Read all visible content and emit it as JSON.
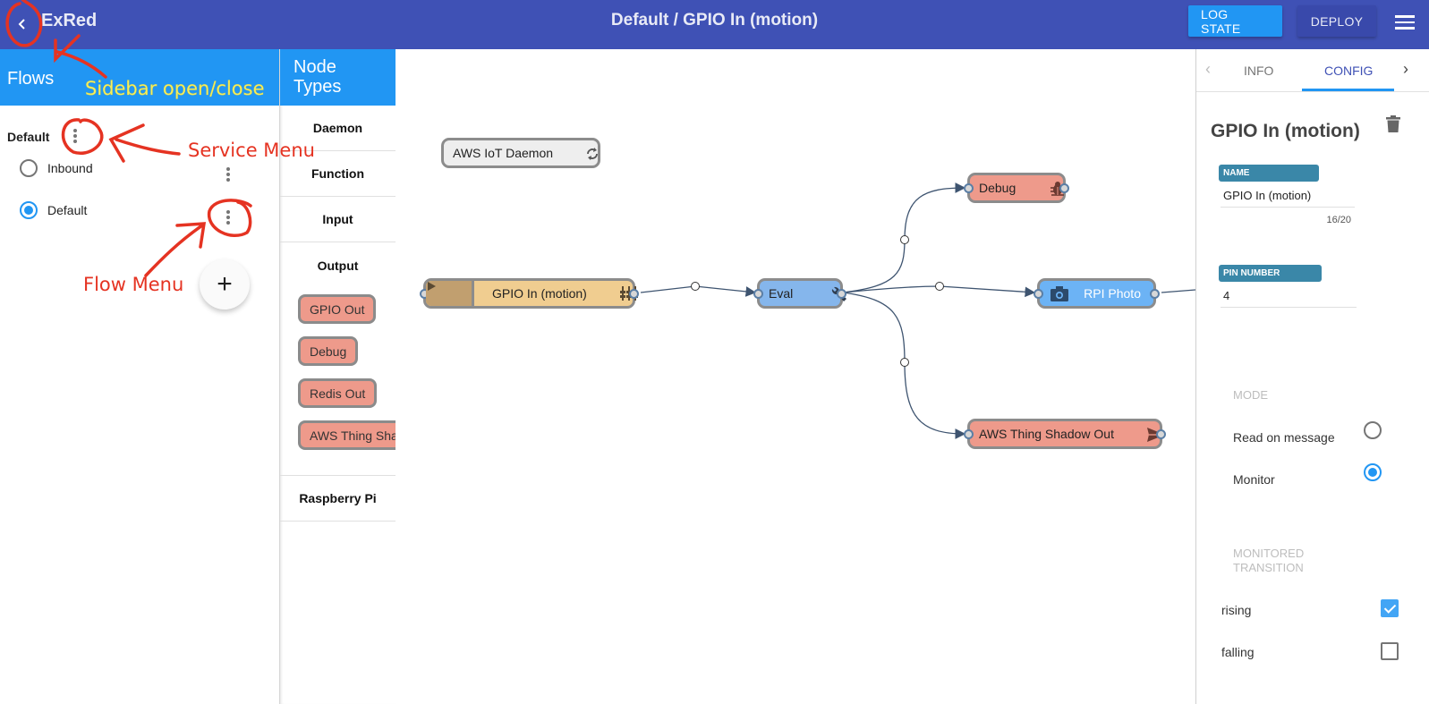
{
  "appbar": {
    "back_icon": "chevron-left-icon",
    "brand": "ExRed",
    "title": "Default / GPIO In (motion)",
    "log_state_label": "LOG STATE",
    "deploy_label": "DEPLOY",
    "menu_icon": "hamburger-menu-icon"
  },
  "flows_sidebar": {
    "header": "Flows",
    "service": {
      "name": "Default",
      "menu_icon": "more-vert-icon"
    },
    "flows": [
      {
        "label": "Inbound",
        "selected": false
      },
      {
        "label": "Default",
        "selected": true
      }
    ],
    "add_button_label": "+"
  },
  "annotations": {
    "sidebar": "Sidebar open/close",
    "service_menu": "Service Menu",
    "flow_menu": "Flow Menu"
  },
  "node_types": {
    "header_line1": "Node",
    "header_line2": "Types",
    "categories": [
      {
        "label": "Daemon"
      },
      {
        "label": "Function"
      },
      {
        "label": "Input"
      },
      {
        "label": "Output",
        "expanded": true,
        "nodes": [
          "GPIO Out",
          "Debug",
          "Redis Out",
          "AWS Thing Shadow Out"
        ]
      },
      {
        "label": "Raspberry Pi"
      }
    ]
  },
  "canvas": {
    "nodes": [
      {
        "id": "aws-iot-daemon",
        "label": "AWS IoT Daemon",
        "icon": "sync-icon",
        "color": "#eeeeee"
      },
      {
        "id": "gpio-in",
        "label": "GPIO In (motion)",
        "icon": "sliders-icon",
        "color": "#f0cd90",
        "trigger_color": "#c19f6f"
      },
      {
        "id": "eval",
        "label": "Eval",
        "icon": "wrench-icon",
        "color": "#85b6ec"
      },
      {
        "id": "debug",
        "label": "Debug",
        "icon": "bug-icon",
        "color": "#ee9a8b"
      },
      {
        "id": "rpi-photo",
        "label": "RPI Photo",
        "icon": "camera-icon",
        "color": "#6cb3f5"
      },
      {
        "id": "aws-shadow-out",
        "label": "AWS Thing Shadow Out",
        "icon": "send-icon",
        "color": "#ee9a8b"
      }
    ],
    "wires": [
      {
        "from": "gpio-in",
        "to": "eval"
      },
      {
        "from": "eval",
        "to": "debug"
      },
      {
        "from": "eval",
        "to": "rpi-photo"
      },
      {
        "from": "eval",
        "to": "aws-shadow-out"
      }
    ]
  },
  "panel": {
    "tabs": [
      {
        "label": "INFO",
        "active": false
      },
      {
        "label": "CONFIG",
        "active": true
      }
    ],
    "title": "GPIO In (motion)",
    "delete_icon": "trash-icon",
    "fields": {
      "name": {
        "label": "NAME",
        "value": "GPIO In (motion)",
        "counter": "16/20"
      },
      "pin": {
        "label": "PIN NUMBER",
        "value": "4"
      }
    },
    "mode": {
      "label": "MODE",
      "options": [
        {
          "label": "Read on message",
          "selected": false
        },
        {
          "label": "Monitor",
          "selected": true
        }
      ]
    },
    "transition": {
      "label_line1": "MONITORED",
      "label_line2": "TRANSITION",
      "options": [
        {
          "label": "rising",
          "checked": true
        },
        {
          "label": "falling",
          "checked": false
        }
      ]
    }
  }
}
